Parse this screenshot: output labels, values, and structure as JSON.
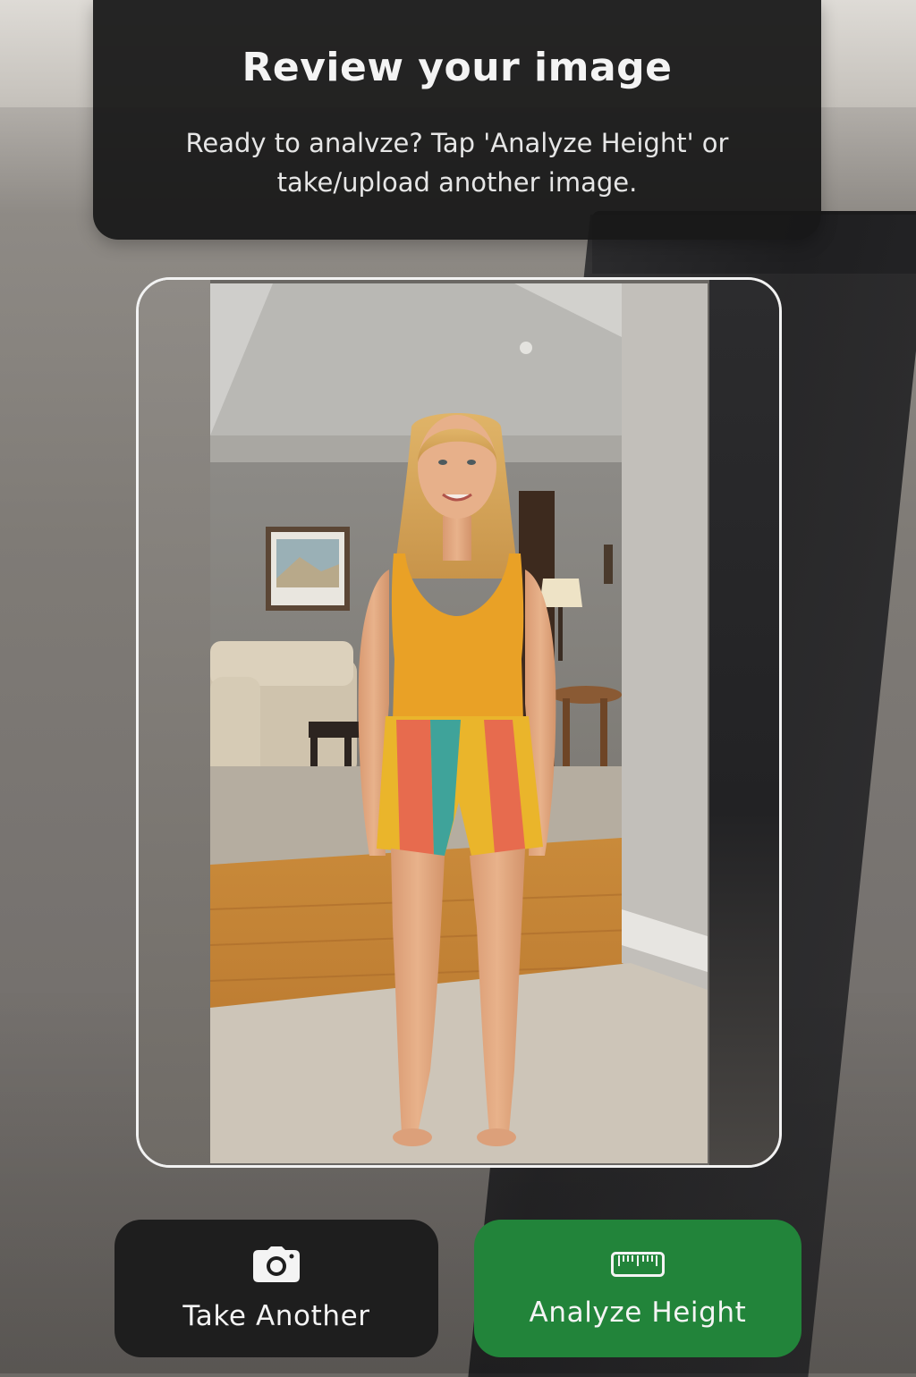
{
  "header": {
    "title": "Review your image",
    "subtitle": "Ready to analvze? Tap 'Analyze Height' or take/upload another image."
  },
  "preview": {
    "image_description_icon": "person-photo"
  },
  "actions": {
    "take_another": {
      "label": "Take Another",
      "icon": "camera-icon"
    },
    "analyze_height": {
      "label": "Analyze Height",
      "icon": "ruler-icon"
    }
  },
  "colors": {
    "primary_action": "#22843a",
    "secondary_action": "#1e1e1e",
    "header_background": "#181818",
    "frame_border": "#f2f2f2"
  }
}
